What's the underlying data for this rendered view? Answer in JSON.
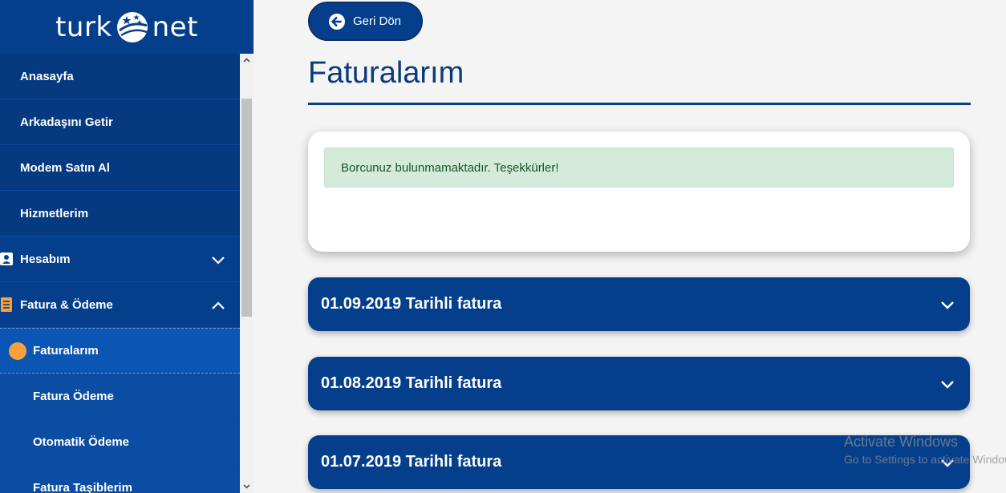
{
  "brand": {
    "logo_left": "turk",
    "logo_right": "net"
  },
  "colors": {
    "primary": "#053f8c",
    "active_dot": "#f5a23a",
    "alert_bg": "#d4ebdb",
    "alert_text": "#18522c"
  },
  "sidebar": {
    "items": [
      {
        "label": "Anasayfa"
      },
      {
        "label": "Arkadaşını Getir"
      },
      {
        "label": "Modem Satın Al"
      },
      {
        "label": "Hizmetlerim"
      },
      {
        "label": "Hesabım",
        "icon": "contact-card-icon",
        "chevron": "chevron-down-icon"
      },
      {
        "label": "Fatura & Ödeme",
        "icon": "receipt-icon",
        "chevron": "chevron-up-icon"
      },
      {
        "label": "Faturalarım",
        "active": true
      },
      {
        "label": "Fatura Ödeme"
      },
      {
        "label": "Otomatik Ödeme"
      },
      {
        "label": "Fatura Taşiblerim"
      }
    ]
  },
  "main": {
    "back_button": "Geri Dön",
    "title": "Faturalarım",
    "alert": "Borcunuz bulunmamaktadır. Teşekkürler!",
    "invoices": [
      {
        "label": "01.09.2019 Tarihli fatura"
      },
      {
        "label": "01.08.2019 Tarihli fatura"
      },
      {
        "label": "01.07.2019 Tarihli fatura"
      }
    ]
  },
  "watermark": {
    "line1": "Activate Windows",
    "line2": "Go to Settings to activate Windows."
  }
}
